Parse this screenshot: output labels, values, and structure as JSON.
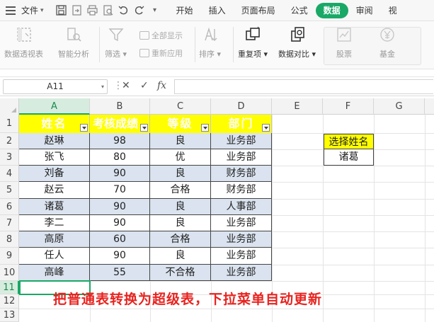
{
  "menubar": {
    "file_label": "文件",
    "tabs": [
      {
        "label": "开始",
        "active": false
      },
      {
        "label": "插入",
        "active": false
      },
      {
        "label": "页面布局",
        "active": false
      },
      {
        "label": "公式",
        "active": false
      },
      {
        "label": "数据",
        "active": true
      },
      {
        "label": "审阅",
        "active": false
      },
      {
        "label": "视",
        "active": false
      }
    ],
    "accent_color": "#1aa867"
  },
  "ribbon": {
    "pivot_label": "数据透视表",
    "smart_label": "智能分析",
    "filter_label": "筛选",
    "show_all_label": "全部显示",
    "reapply_label": "重新应用",
    "sort_label": "排序",
    "dup_label": "重复项",
    "compare_label": "数据对比",
    "stock_label": "股票",
    "fund_label": "基金"
  },
  "formula_bar": {
    "name_box": "A11",
    "fx_label": "fx",
    "formula": ""
  },
  "columns": [
    "A",
    "B",
    "C",
    "D",
    "E",
    "F",
    "G"
  ],
  "rows": [
    "1",
    "2",
    "3",
    "4",
    "5",
    "6",
    "7",
    "8",
    "9",
    "10",
    "11",
    "12",
    "13"
  ],
  "table": {
    "headers": [
      "姓名",
      "考核成绩",
      "等级",
      "部门"
    ],
    "rows": [
      [
        "赵琳",
        "98",
        "良",
        "业务部"
      ],
      [
        "张飞",
        "80",
        "优",
        "业务部"
      ],
      [
        "刘备",
        "90",
        "良",
        "财务部"
      ],
      [
        "赵云",
        "70",
        "合格",
        "财务部"
      ],
      [
        "诸葛",
        "90",
        "良",
        "人事部"
      ],
      [
        "李二",
        "90",
        "良",
        "业务部"
      ],
      [
        "高原",
        "60",
        "合格",
        "业务部"
      ],
      [
        "任人",
        "90",
        "良",
        "业务部"
      ],
      [
        "高峰",
        "55",
        "不合格",
        "业务部"
      ]
    ],
    "header_bg": "#ffff00",
    "band_bg": "#dae3ef"
  },
  "lookup": {
    "label": "选择姓名",
    "value": "诸葛"
  },
  "caption": "把普通表转换为超级表，下拉菜单自动更新"
}
